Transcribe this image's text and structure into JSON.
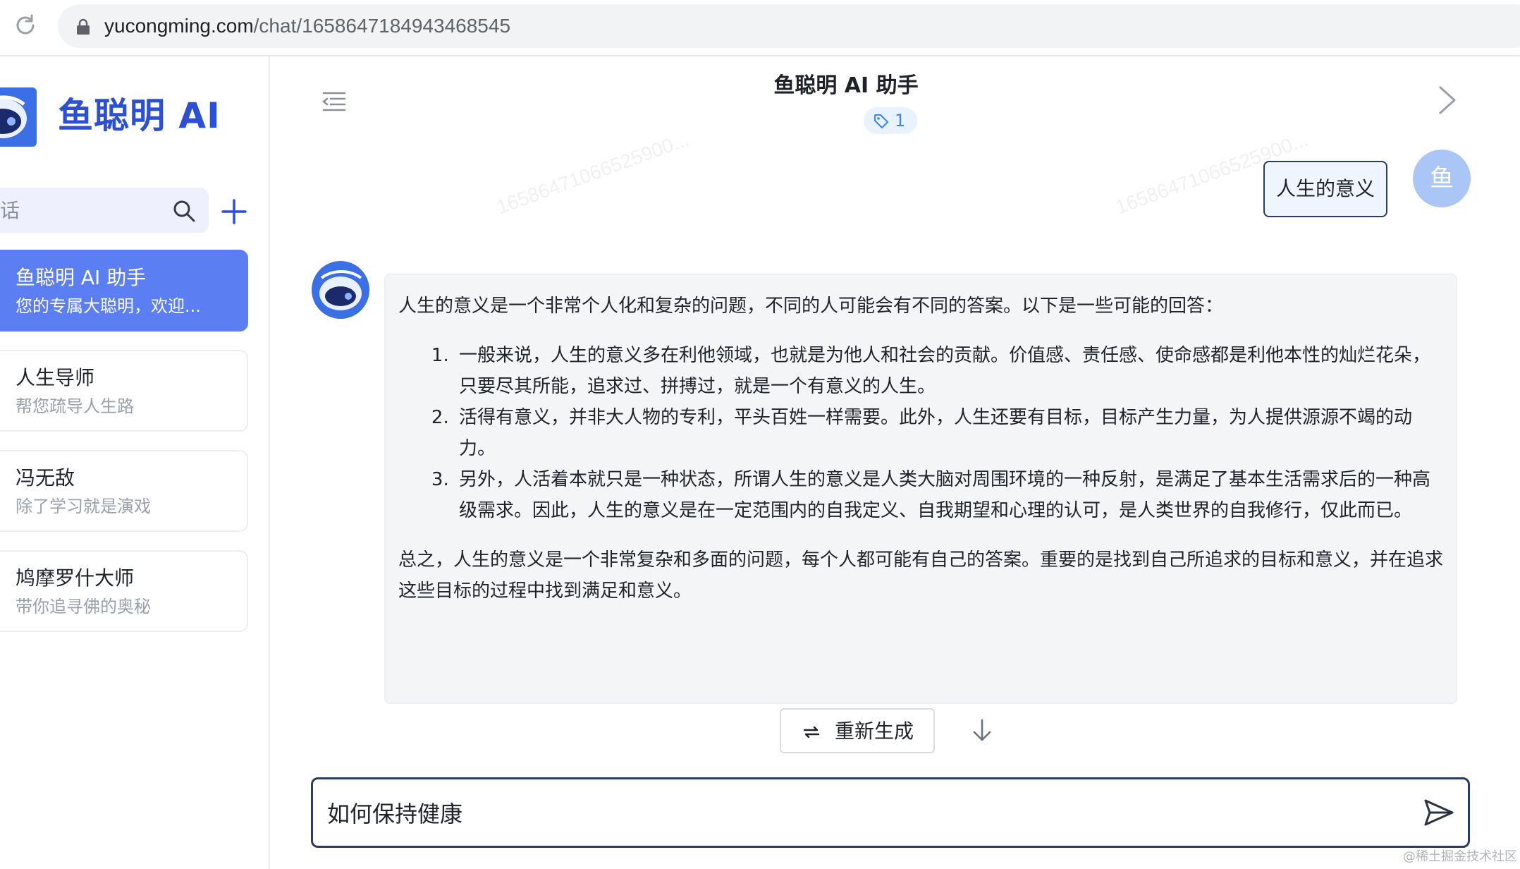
{
  "browser": {
    "url_host": "yucongming.com",
    "url_path": "/chat/1658647184943468545"
  },
  "sidebar": {
    "brand_title": "鱼聪明 AI",
    "search_placeholder": "话",
    "sessions": [
      {
        "name": "鱼聪明 AI 助手",
        "desc": "您的专属大聪明，欢迎...",
        "active": true
      },
      {
        "name": "人生导师",
        "desc": "帮您疏导人生路",
        "active": false
      },
      {
        "name": "冯无敌",
        "desc": "除了学习就是演戏",
        "active": false
      },
      {
        "name": "鸠摩罗什大师",
        "desc": "带你追寻佛的奥秘",
        "active": false
      }
    ]
  },
  "chat": {
    "title": "鱼聪明 AI 助手",
    "tag_count": "1",
    "watermark": "16586471066525900...",
    "user_message": "人生的意义",
    "user_avatar_text": "鱼",
    "bot_intro": "人生的意义是一个非常个人化和复杂的问题，不同的人可能会有不同的答案。以下是一些可能的回答：",
    "bot_points": [
      "一般来说，人生的意义多在利他领域，也就是为他人和社会的贡献。价值感、责任感、使命感都是利他本性的灿烂花朵，只要尽其所能，追求过、拼搏过，就是一个有意义的人生。",
      "活得有意义，并非大人物的专利，平头百姓一样需要。此外，人生还要有目标，目标产生力量，为人提供源源不竭的动力。",
      "另外，人活着本就只是一种状态，所谓人生的意义是人类大脑对周围环境的一种反射，是满足了基本生活需求后的一种高级需求。因此，人生的意义是在一定范围内的自我定义、自我期望和心理的认可，是人类世界的自我修行，仅此而已。"
    ],
    "bot_summary": "总之，人生的意义是一个非常复杂和多面的问题，每个人都可能有自己的答案。重要的是找到自己所追求的目标和意义，并在追求这些目标的过程中找到满足和意义。",
    "regenerate_label": "重新生成",
    "composer_value": "如何保持健康"
  },
  "footer": {
    "credit": "@稀土掘金技术社区"
  },
  "colors": {
    "accent": "#5b7ef2",
    "brand": "#2b4fd6",
    "bubble_border": "#2c3a66",
    "bot_bubble_bg": "#f4f5f7"
  },
  "icons": [
    "reload-icon",
    "lock-icon",
    "search-icon",
    "add-icon",
    "menu-toggle-icon",
    "tag-icon",
    "chevron-right-icon",
    "regenerate-icon",
    "arrow-down-icon",
    "send-icon"
  ]
}
